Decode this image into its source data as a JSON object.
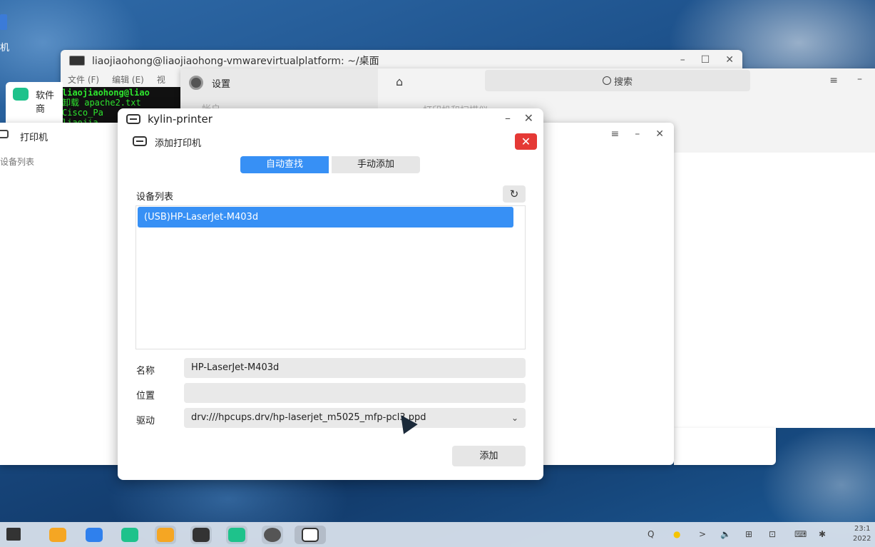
{
  "desktop": {
    "label": "机"
  },
  "terminal": {
    "title": "liaojiaohong@liaojiaohong-vmwarevirtualplatform: ~/桌面",
    "menu": [
      "文件 (F)",
      "编辑 (E)",
      "视"
    ],
    "lines": [
      "liaojiaohong@liao",
      "卸载 apache2.txt",
      "Cisco_Pa",
      "liaojia"
    ],
    "controls": {
      "minimize": "–",
      "maximize": "☐",
      "close": "✕"
    }
  },
  "store": {
    "label": "软件商"
  },
  "settings": {
    "title": "设置",
    "sidebar_clip": "帐户",
    "search_placeholder": "搜索",
    "heading_clip": "打印机和扫描仪",
    "menu_icon": "≡",
    "minimize": "–"
  },
  "printer_window": {
    "title": "打印机",
    "list_label": "设备列表",
    "controls": {
      "menu": "≡",
      "minimize": "–",
      "close": "✕"
    }
  },
  "dialog": {
    "app_title": "kylin-printer",
    "subtitle": "添加打印机",
    "minimize": "–",
    "close": "✕",
    "red_close": "✕",
    "tabs": {
      "auto": "自动查找",
      "manual": "手动添加"
    },
    "device_list_label": "设备列表",
    "refresh": "↻",
    "devices": [
      "(USB)HP-LaserJet-M403d"
    ],
    "fields": {
      "name_label": "名称",
      "name_value": "HP-LaserJet-M403d",
      "location_label": "位置",
      "location_value": "",
      "driver_label": "驱动",
      "driver_value": "drv:///hpcups.drv/hp-laserjet_m5025_mfp-pcl3.ppd"
    },
    "chevron": "⌄",
    "add_button": "添加"
  },
  "taskbar": {
    "tray": [
      "Q",
      "●",
      ">",
      "🔈",
      "⊞",
      "⊡",
      "⌨",
      "✱"
    ],
    "clock_time": "23:1",
    "clock_date": "2022"
  }
}
